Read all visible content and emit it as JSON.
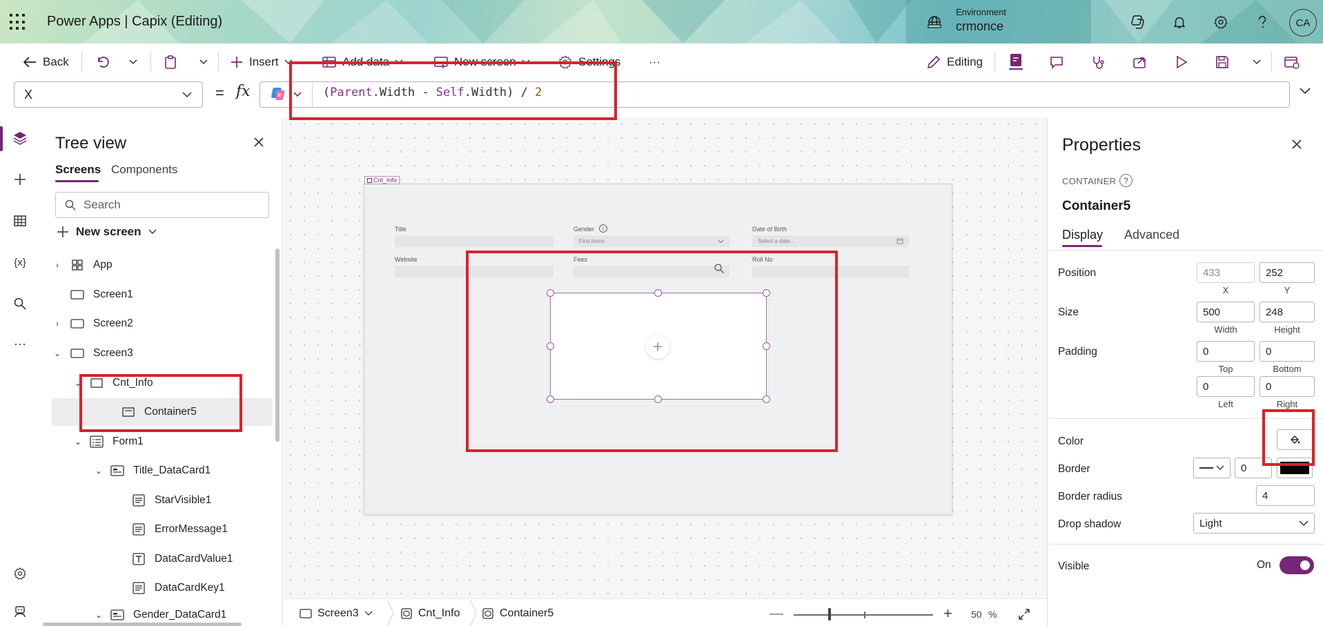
{
  "app": {
    "title": "Power Apps  |  Capix (Editing)",
    "environment_label": "Environment",
    "environment_name": "crmonce",
    "avatar_initials": "CA",
    "brand_color": "#742774"
  },
  "commands": {
    "back": "Back",
    "insert": "Insert",
    "add_data": "Add data",
    "new_screen": "New screen",
    "settings": "Settings",
    "more": "···",
    "editing": "Editing"
  },
  "formula_bar": {
    "property": "X",
    "equals": "=",
    "fx": "fx",
    "formula_parts": [
      "(",
      "Parent",
      ".Width - ",
      "Self",
      ".Width) / ",
      "2"
    ]
  },
  "tree_view": {
    "title": "Tree view",
    "tabs": [
      "Screens",
      "Components"
    ],
    "search_placeholder": "Search",
    "new_screen": "New screen",
    "items": [
      {
        "label": "App",
        "icon": "app-icon"
      },
      {
        "label": "Screen1",
        "icon": "screen-icon"
      },
      {
        "label": "Screen2",
        "icon": "screen-icon"
      },
      {
        "label": "Screen3",
        "icon": "screen-icon"
      },
      {
        "label": "Cnt_Info",
        "icon": "container-icon"
      },
      {
        "label": "Container5",
        "icon": "container-icon"
      },
      {
        "label": "Form1",
        "icon": "form-icon"
      },
      {
        "label": "Title_DataCard1",
        "icon": "datacard-icon"
      },
      {
        "label": "StarVisible1",
        "icon": "label-icon"
      },
      {
        "label": "ErrorMessage1",
        "icon": "label-icon"
      },
      {
        "label": "DataCardValue1",
        "icon": "textinput-icon"
      },
      {
        "label": "DataCardKey1",
        "icon": "label-icon"
      },
      {
        "label": "Gender_DataCard1",
        "icon": "datacard-icon"
      }
    ]
  },
  "canvas": {
    "container_tag": "Cnt_Info",
    "fields": {
      "title": "Title",
      "gender": "Gender",
      "gender_placeholder": "Find items",
      "dob": "Date of Birth",
      "dob_placeholder": "Select a date...",
      "website": "Website",
      "fees": "Fees",
      "roll_no": "Roll No"
    }
  },
  "status_bar": {
    "breadcrumbs": [
      "Screen3",
      "Cnt_Info",
      "Container5"
    ],
    "zoom": "50",
    "zoom_unit": "%"
  },
  "properties": {
    "title": "Properties",
    "type": "CONTAINER",
    "name": "Container5",
    "tabs": [
      "Display",
      "Advanced"
    ],
    "position_label": "Position",
    "x": "433",
    "y": "252",
    "x_caption": "X",
    "y_caption": "Y",
    "size_label": "Size",
    "width": "500",
    "height": "248",
    "width_caption": "Width",
    "height_caption": "Height",
    "padding_label": "Padding",
    "pad_top": "0",
    "pad_bottom": "0",
    "pad_left": "0",
    "pad_right": "0",
    "top_caption": "Top",
    "bottom_caption": "Bottom",
    "left_caption": "Left",
    "right_caption": "Right",
    "color_label": "Color",
    "border_label": "Border",
    "border_width": "0",
    "border_color": "#000000",
    "border_radius_label": "Border radius",
    "border_radius": "4",
    "drop_shadow_label": "Drop shadow",
    "drop_shadow": "Light",
    "visible_label": "Visible",
    "visible_state": "On"
  }
}
